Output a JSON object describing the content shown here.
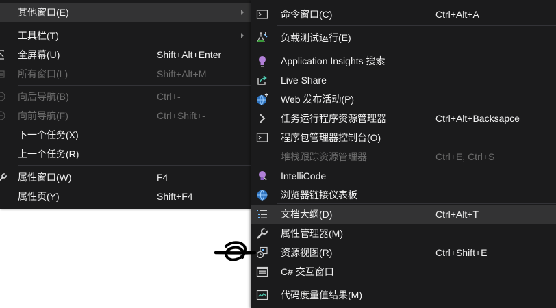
{
  "left_menu": {
    "items": [
      {
        "label": "其他窗口(E)",
        "shortcut": "",
        "disabled": false,
        "submenu": true,
        "icon": ""
      },
      {
        "label": "工具栏(T)",
        "shortcut": "",
        "disabled": false,
        "submenu": true,
        "icon": ""
      },
      {
        "label": "全屏幕(U)",
        "shortcut": "Shift+Alt+Enter",
        "disabled": false,
        "submenu": false,
        "icon": "fullscreen-icon"
      },
      {
        "label": "所有窗口(L)",
        "shortcut": "Shift+Alt+M",
        "disabled": true,
        "submenu": false,
        "icon": "all-windows-icon"
      },
      {
        "label": "向后导航(B)",
        "shortcut": "Ctrl+-",
        "disabled": true,
        "submenu": false,
        "icon": "navigate-back-icon"
      },
      {
        "label": "向前导航(F)",
        "shortcut": "Ctrl+Shift+-",
        "disabled": true,
        "submenu": false,
        "icon": "navigate-forward-icon"
      },
      {
        "label": "下一个任务(X)",
        "shortcut": "",
        "disabled": false,
        "submenu": false,
        "icon": ""
      },
      {
        "label": "上一个任务(R)",
        "shortcut": "",
        "disabled": false,
        "submenu": false,
        "icon": ""
      },
      {
        "label": "属性窗口(W)",
        "shortcut": "F4",
        "disabled": false,
        "submenu": false,
        "icon": "wrench-icon"
      },
      {
        "label": "属性页(Y)",
        "shortcut": "Shift+F4",
        "disabled": false,
        "submenu": false,
        "icon": ""
      }
    ]
  },
  "right_menu": {
    "items": [
      {
        "label": "命令窗口(C)",
        "shortcut": "Ctrl+Alt+A",
        "disabled": false,
        "icon": "command-window-icon"
      },
      {
        "label": "负载测试运行(E)",
        "shortcut": "",
        "disabled": false,
        "icon": "flask-icon"
      },
      {
        "label": "Application Insights 搜索",
        "shortcut": "",
        "disabled": false,
        "icon": "lightbulb-icon"
      },
      {
        "label": "Live Share",
        "shortcut": "",
        "disabled": false,
        "icon": "live-share-icon"
      },
      {
        "label": "Web 发布活动(P)",
        "shortcut": "",
        "disabled": false,
        "icon": "globe-publish-icon"
      },
      {
        "label": "任务运行程序资源管理器",
        "shortcut": "Ctrl+Alt+Backsapce",
        "disabled": false,
        "icon": "chevron-right-icon"
      },
      {
        "label": "程序包管理器控制台(O)",
        "shortcut": "",
        "disabled": false,
        "icon": "console-icon"
      },
      {
        "label": "堆栈跟踪资源管理器",
        "shortcut": "Ctrl+E, Ctrl+S",
        "disabled": true,
        "icon": ""
      },
      {
        "label": "IntelliCode",
        "shortcut": "",
        "disabled": false,
        "icon": "intellicode-icon"
      },
      {
        "label": "浏览器链接仪表板",
        "shortcut": "",
        "disabled": false,
        "icon": "globe-icon"
      },
      {
        "label": "文档大纲(D)",
        "shortcut": "Ctrl+Alt+T",
        "disabled": false,
        "icon": "outline-icon"
      },
      {
        "label": "属性管理器(M)",
        "shortcut": "",
        "disabled": false,
        "icon": "wrench-icon"
      },
      {
        "label": "资源视图(R)",
        "shortcut": "Ctrl+Shift+E",
        "disabled": false,
        "icon": "resource-view-icon"
      },
      {
        "label": "C# 交互窗口",
        "shortcut": "",
        "disabled": false,
        "icon": "csharp-interactive-icon"
      },
      {
        "label": "代码度量值结果(M)",
        "shortcut": "",
        "disabled": false,
        "icon": "code-metrics-icon"
      }
    ]
  },
  "colors": {
    "menu_bg": "#1b1b1c",
    "text": "#f1f1f1",
    "disabled_text": "#6d6d6d",
    "highlight": "#333334",
    "separator": "#333337",
    "accent_blue": "#75beff",
    "accent_purple": "#b180d7"
  }
}
